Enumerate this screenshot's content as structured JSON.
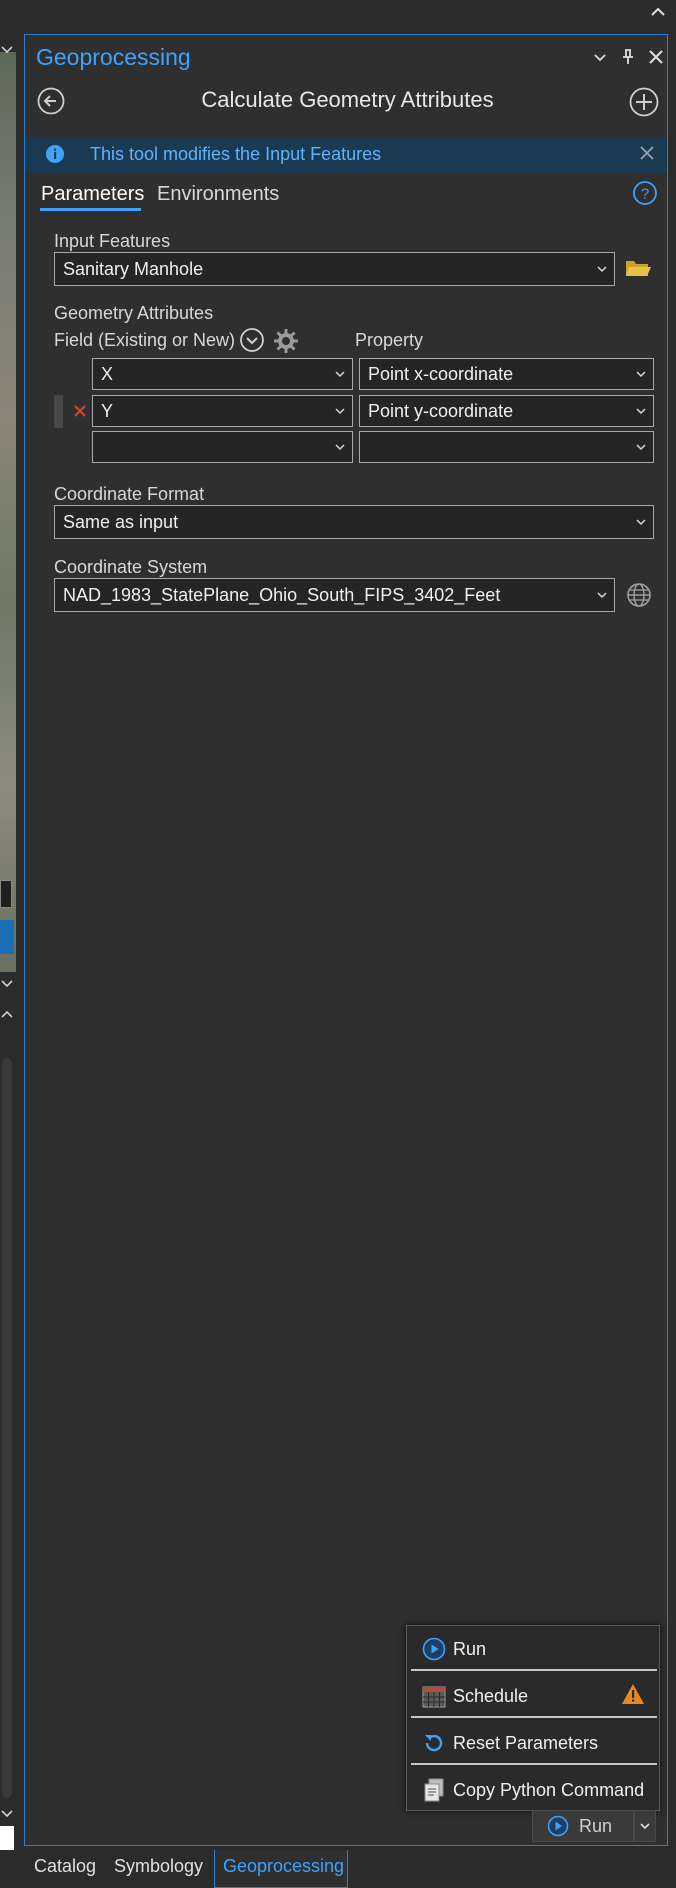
{
  "panel": {
    "title": "Geoprocessing",
    "tool_title": "Calculate Geometry Attributes",
    "info_message": "This tool modifies the Input Features"
  },
  "tabs": [
    "Parameters",
    "Environments"
  ],
  "params": {
    "input_features_label": "Input Features",
    "input_features_value": "Sanitary Manhole",
    "geometry_attributes_label": "Geometry Attributes",
    "field_header": "Field (Existing or New)",
    "property_header": "Property",
    "rows": [
      {
        "field": "X",
        "property": "Point x-coordinate"
      },
      {
        "field": "Y",
        "property": "Point y-coordinate"
      },
      {
        "field": "",
        "property": ""
      }
    ],
    "coordinate_format_label": "Coordinate Format",
    "coordinate_format_value": "Same as input",
    "coordinate_system_label": "Coordinate System",
    "coordinate_system_value": "NAD_1983_StatePlane_Ohio_South_FIPS_3402_Feet"
  },
  "run_menu": {
    "items": [
      "Run",
      "Schedule",
      "Reset Parameters",
      "Copy Python Command"
    ]
  },
  "run_button_label": "Run",
  "bottom_tabs": [
    "Catalog",
    "Symbology",
    "Geoprocessing"
  ],
  "colors": {
    "accent": "#3da3ff",
    "panel_bg": "#2f2f2f",
    "info_bg": "#1a3a52",
    "warning": "#e8891e",
    "delete": "#d9452b"
  }
}
